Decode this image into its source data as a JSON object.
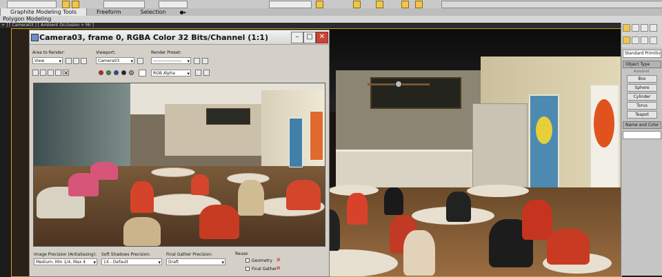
{
  "ribbon": {
    "tabs": [
      {
        "label": "Graphite Modeling Tools",
        "active": true
      },
      {
        "label": "Freeform",
        "active": false
      },
      {
        "label": "Selection",
        "active": false
      }
    ],
    "sub_label": "Polygon Modeling"
  },
  "viewport": {
    "label": "+ ] [ Camera03 ] [ Ambient Occlusion + Mr ]"
  },
  "render_window": {
    "title": "Camera03, frame 0, RGBA Color 32 Bits/Channel (1:1)",
    "area_to_render": {
      "label": "Area to Render:",
      "value": "View"
    },
    "viewport": {
      "label": "Viewport:",
      "value": "Camera03"
    },
    "render_preset": {
      "label": "Render Preset:",
      "value": "-------------------"
    },
    "channel": {
      "value": "RGB Alpha"
    },
    "colors": {
      "red": "#d0262a",
      "green": "#2f9a3a",
      "blue": "#2a47c4"
    },
    "bottom": {
      "image_precision": {
        "label": "Image Precision (Antialiasing):",
        "value": "Medium: Min 1/4, Max 4"
      },
      "soft_shadows": {
        "label": "Soft Shadows Precision:",
        "value": "1X - Default"
      },
      "final_gather": {
        "label": "Final Gather Precision:",
        "value": "Draft"
      },
      "reuse": {
        "label": "Reuse",
        "geometry": "Geometry",
        "final_gather": "Final Gather"
      }
    }
  },
  "command_panel": {
    "dropdown": "Standard Primitives",
    "object_type_title": "Object Type",
    "autogrid": "AutoGrid",
    "buttons": [
      "Box",
      "Sphere",
      "Cylinder",
      "Torus",
      "Teapot"
    ],
    "name_color_title": "Name and Color"
  }
}
